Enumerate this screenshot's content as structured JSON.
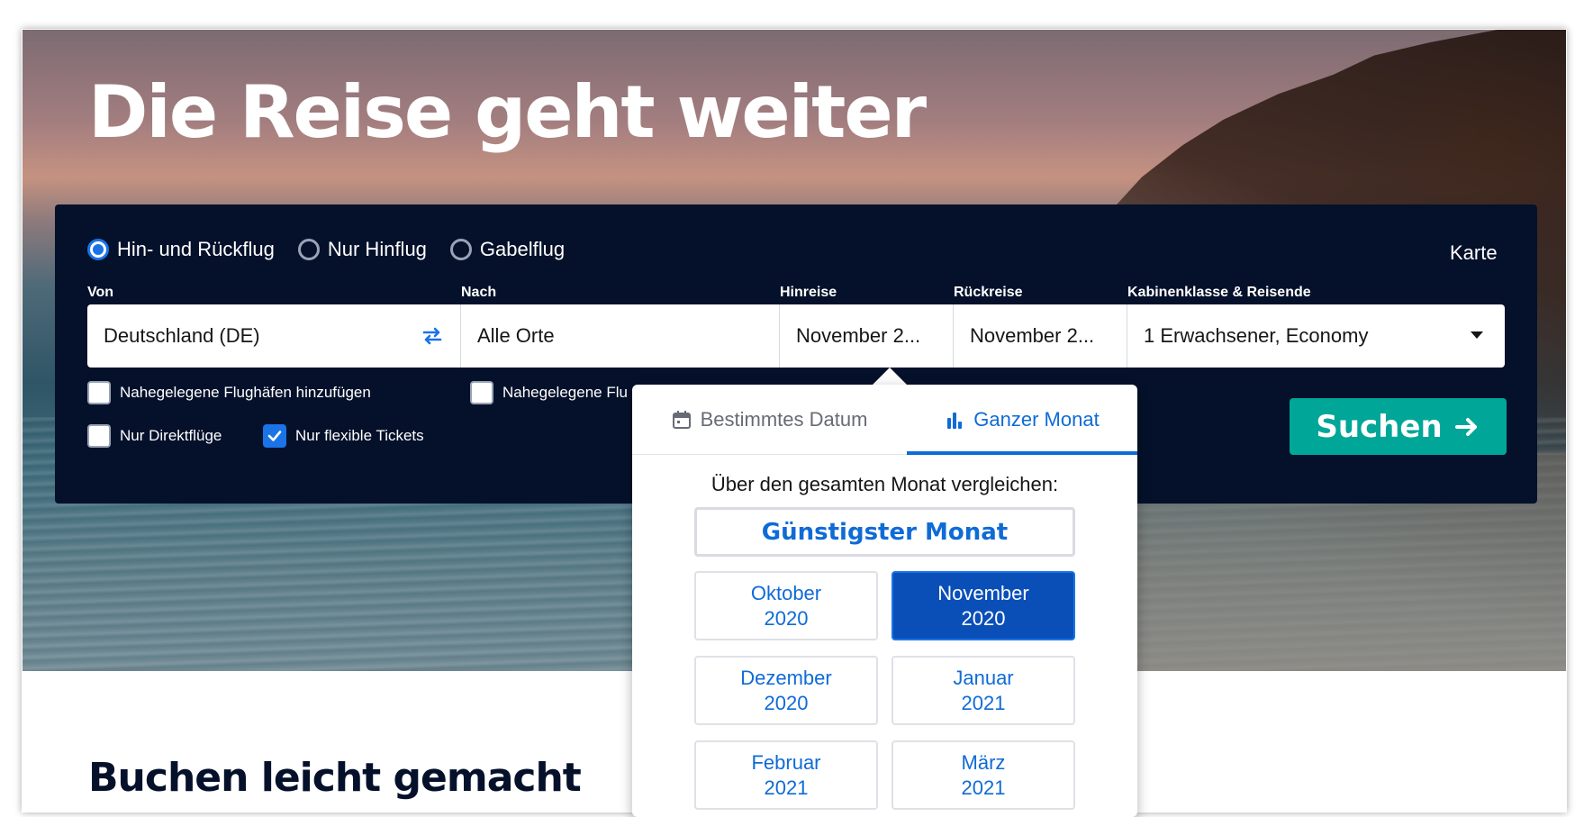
{
  "hero": {
    "headline": "Die Reise geht weiter"
  },
  "trip_types": [
    {
      "label": "Hin- und Rückflug",
      "checked": true
    },
    {
      "label": "Nur Hinflug",
      "checked": false
    },
    {
      "label": "Gabelflug",
      "checked": false
    }
  ],
  "map_link": "Karte",
  "labels": {
    "from": "Von",
    "to": "Nach",
    "depart": "Hinreise",
    "return": "Rückreise",
    "cabin": "Kabinenklasse & Reisende"
  },
  "values": {
    "from": "Deutschland (DE)",
    "to": "Alle Orte",
    "depart": "November 2...",
    "return": "November 2...",
    "cabin": "1 Erwachsener, Economy"
  },
  "checkboxes": {
    "nearby_from": {
      "label": "Nahegelegene Flughäfen hinzufügen",
      "checked": false
    },
    "nearby_to": {
      "label": "Nahegelegene Flu",
      "checked": false
    },
    "direct": {
      "label": "Nur Direktflüge",
      "checked": false
    },
    "flexible": {
      "label": "Nur flexible Tickets",
      "checked": true
    }
  },
  "search_button": "Suchen",
  "date_popup": {
    "tabs": [
      {
        "label": "Bestimmtes Datum",
        "icon": "calendar-icon",
        "active": false
      },
      {
        "label": "Ganzer Monat",
        "icon": "bar-chart-icon",
        "active": true
      }
    ],
    "compare_text": "Über den gesamten Monat vergleichen:",
    "cheapest_label": "Günstigster Monat",
    "months": [
      {
        "month": "Oktober",
        "year": "2020",
        "selected": false
      },
      {
        "month": "November",
        "year": "2020",
        "selected": true
      },
      {
        "month": "Dezember",
        "year": "2020",
        "selected": false
      },
      {
        "month": "Januar",
        "year": "2021",
        "selected": false
      },
      {
        "month": "Februar",
        "year": "2021",
        "selected": false
      },
      {
        "month": "März",
        "year": "2021",
        "selected": false
      }
    ]
  },
  "section_title": "Buchen leicht gemacht",
  "colors": {
    "panel_bg": "#05112b",
    "accent_blue": "#0f6bd6",
    "selected_month": "#0a4fb8",
    "search_button": "#00a698"
  }
}
